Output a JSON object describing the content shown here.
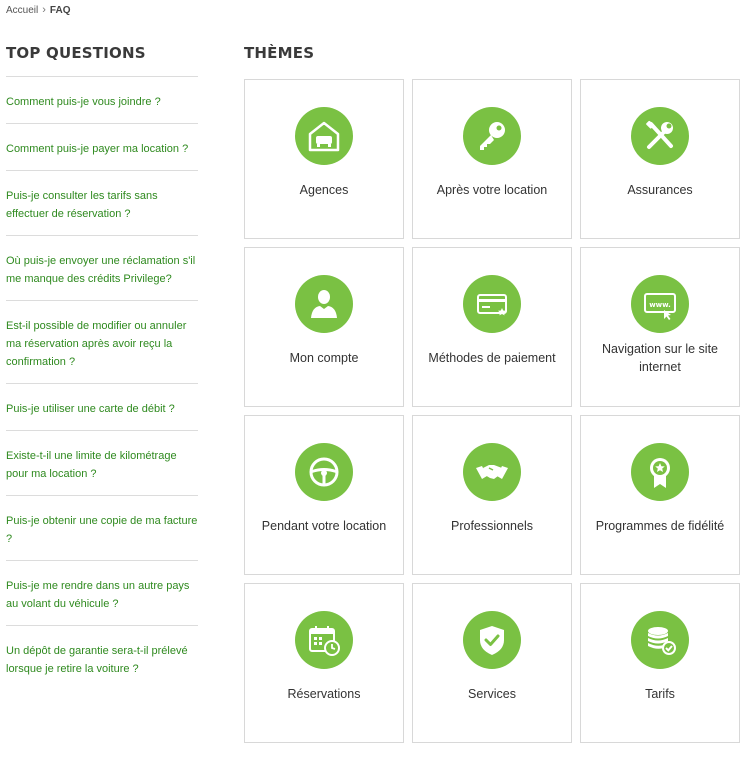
{
  "breadcrumb": {
    "home": "Accueil",
    "current": "FAQ"
  },
  "top_questions": {
    "title": "TOP QUESTIONS",
    "items": [
      "Comment puis-je vous joindre ?",
      "Comment puis-je payer ma location ?",
      "Puis-je consulter les tarifs sans effectuer de réservation ?",
      "Où puis-je envoyer une réclamation s'il me manque des crédits Privilege?",
      "Est-il possible de modifier ou annuler ma réservation après avoir reçu la confirmation ?",
      "Puis-je utiliser une carte de débit ?",
      "Existe-t-il une limite de kilométrage pour ma location ?",
      "Puis-je obtenir une copie de ma facture ?",
      "Puis-je me rendre dans un autre pays au volant du véhicule ?",
      "Un dépôt de garantie sera-t-il prélevé lorsque je retire la voiture ?"
    ]
  },
  "themes": {
    "title": "THÈMES",
    "accent_color": "#7ac143",
    "items": [
      {
        "label": "Agences",
        "icon": "garage-car-icon"
      },
      {
        "label": "Après votre location",
        "icon": "key-icon"
      },
      {
        "label": "Assurances",
        "icon": "tools-icon"
      },
      {
        "label": "Mon compte",
        "icon": "user-icon"
      },
      {
        "label": "Méthodes de paiement",
        "icon": "credit-card-icon"
      },
      {
        "label": "Navigation sur le site internet",
        "icon": "www-icon"
      },
      {
        "label": "Pendant votre location",
        "icon": "steering-wheel-icon"
      },
      {
        "label": "Professionnels",
        "icon": "handshake-icon"
      },
      {
        "label": "Programmes de fidélité",
        "icon": "award-badge-icon"
      },
      {
        "label": "Réservations",
        "icon": "calendar-clock-icon"
      },
      {
        "label": "Services",
        "icon": "shield-check-icon"
      },
      {
        "label": "Tarifs",
        "icon": "coins-check-icon"
      }
    ]
  }
}
